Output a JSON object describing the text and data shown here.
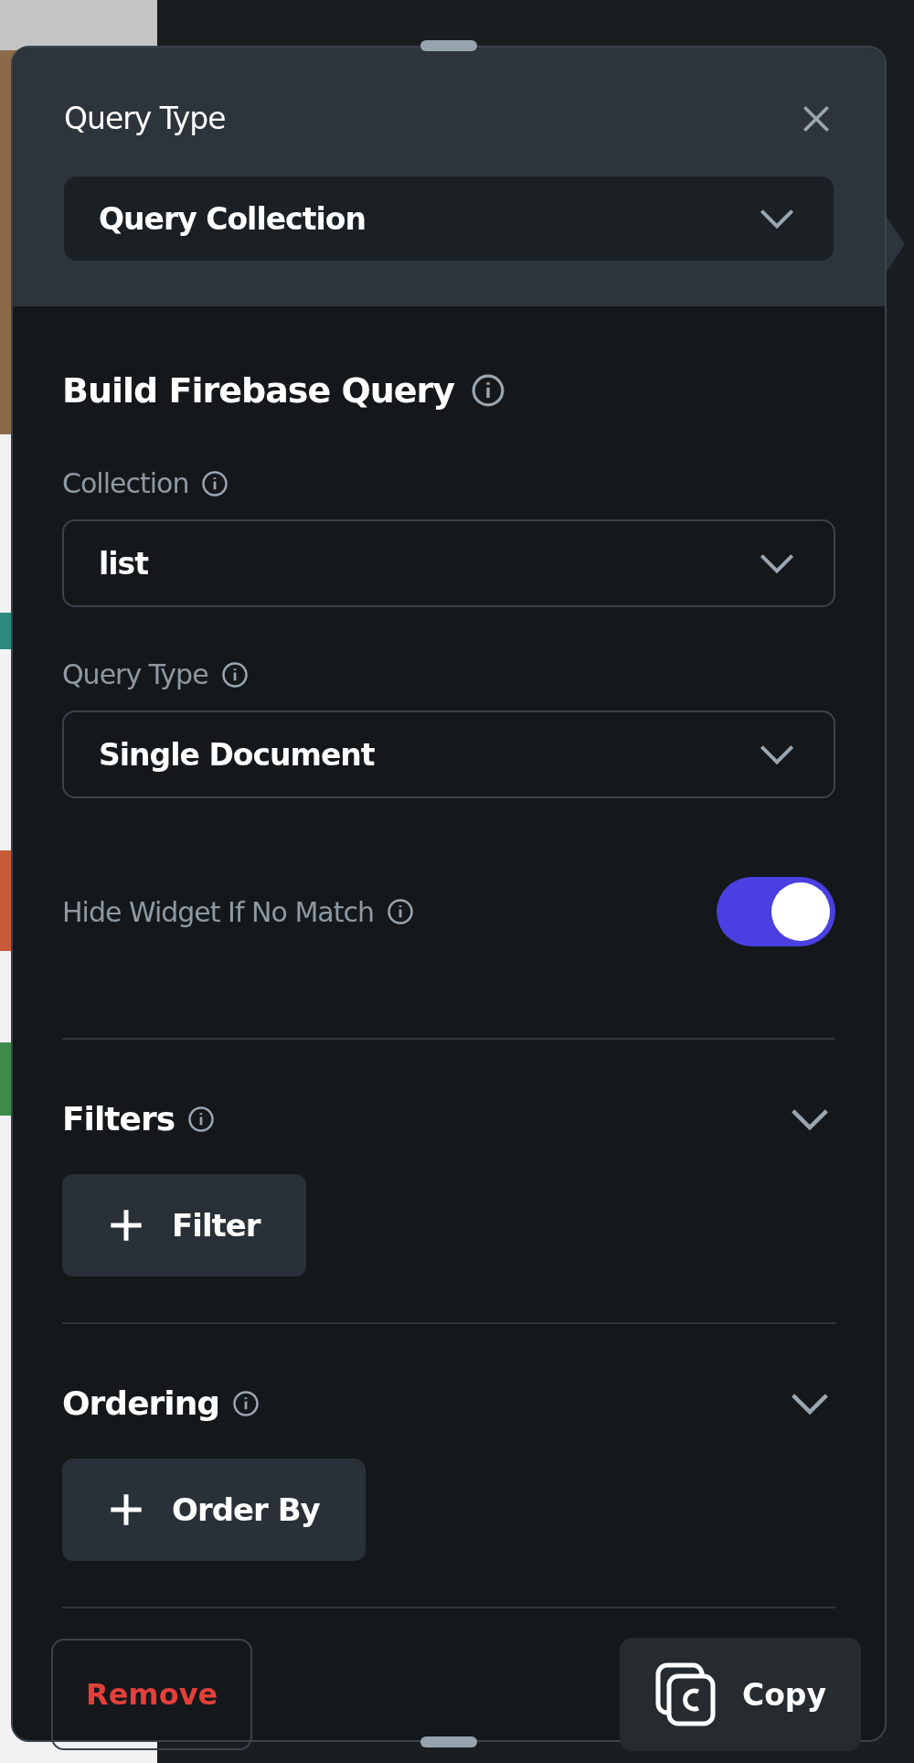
{
  "header": {
    "title": "Query Type",
    "select": {
      "value": "Query Collection"
    }
  },
  "section": {
    "title": "Build Firebase Query"
  },
  "fields": [
    {
      "label": "Collection",
      "value": "list"
    },
    {
      "label": "Query Type",
      "value": "Single Document"
    }
  ],
  "toggle": {
    "label": "Hide Widget If No Match",
    "on": true
  },
  "groups": [
    {
      "title": "Filters",
      "button": "Filter"
    },
    {
      "title": "Ordering",
      "button": "Order By"
    }
  ],
  "footer": {
    "remove": "Remove",
    "copy": "Copy"
  }
}
